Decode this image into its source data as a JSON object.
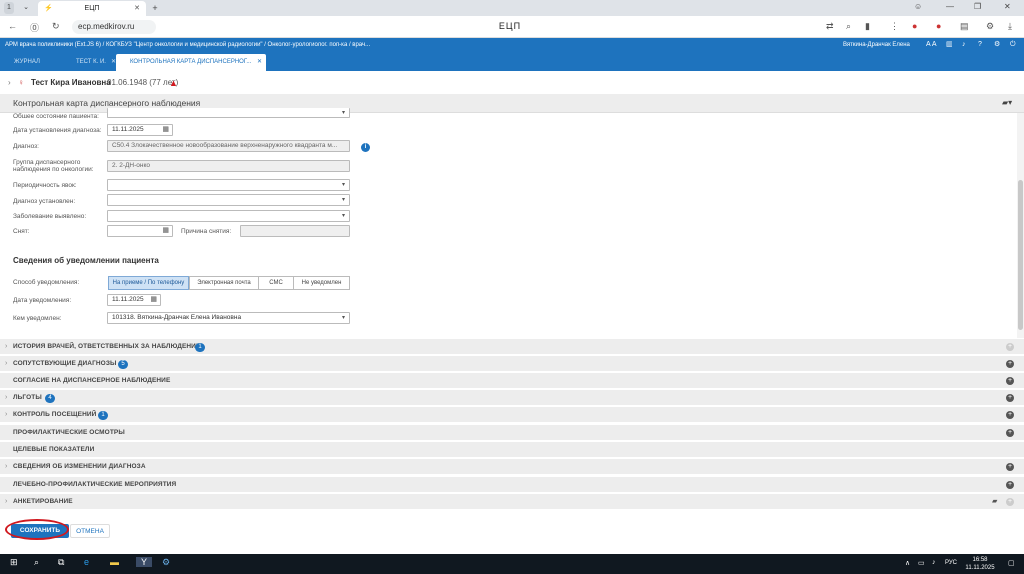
{
  "browser": {
    "tab_counter": "1",
    "tab_title": "ЕЦП",
    "new_tab": "+",
    "url": "ecp.medkirov.ru",
    "page_title": "ЕЦП"
  },
  "app": {
    "header_text": "АРМ врача поликлиники (Ext.JS 6) / КОГКБУЗ \"Центр онкологии и медицинской радиологии\" / Онколог-урологиолог. поп-ка / врач...",
    "user_name": "Вяткина-Дранчак Елена",
    "tabs": [
      {
        "label": "ЖУРНАЛ"
      },
      {
        "label": "ТЕСТ К. И."
      },
      {
        "label": "КОНТРОЛЬНАЯ КАРТА ДИСПАНСЕРНОГ..."
      }
    ]
  },
  "patient": {
    "name": "Тест Кира Ивановна",
    "dob": "01.06.1948 (77 лет)"
  },
  "card": {
    "title": "Контрольная карта диспансерного наблюдения"
  },
  "form": {
    "general_state_label": "Общее состояние пациента:",
    "diag_date_label": "Дата установления диагноза:",
    "diag_date_value": "11.11.2025",
    "diagnosis_label": "Диагноз:",
    "diagnosis_value": "C50.4 Злокачественное новообразование верхненаружного квадранта м...",
    "group_label": "Группа диспансерного наблюдения по онкологии:",
    "group_value": "2. 2-ДН-онко",
    "periodicity_label": "Периодичность явок:",
    "diag_established_label": "Диагноз установлен:",
    "disease_found_label": "Заболевание выявлено:",
    "removed_label": "Снят:",
    "removal_reason_label": "Причина снятия:"
  },
  "notification": {
    "title": "Сведения об уведомлении пациента",
    "method_label": "Способ уведомления:",
    "methods": [
      "На приеме / По телефону",
      "Электронная почта",
      "СМС",
      "Не уведомлен"
    ],
    "date_label": "Дата уведомления:",
    "date_value": "11.11.2025",
    "by_label": "Кем уведомлен:",
    "by_value": "101318. Вяткина-Дранчак Елена Ивановна"
  },
  "sections": [
    {
      "title": "ИСТОРИЯ ВРАЧЕЙ, ОТВЕТСТВЕННЫХ ЗА НАБЛЮДЕНИЕ",
      "badge": "1"
    },
    {
      "title": "СОПУТСТВУЮЩИЕ ДИАГНОЗЫ",
      "badge": "5"
    },
    {
      "title": "СОГЛАСИЕ НА ДИСПАНСЕРНОЕ НАБЛЮДЕНИЕ",
      "badge": ""
    },
    {
      "title": "ЛЬГОТЫ",
      "badge": "4"
    },
    {
      "title": "КОНТРОЛЬ ПОСЕЩЕНИЙ",
      "badge": "1"
    },
    {
      "title": "ПРОФИЛАКТИЧЕСКИЕ ОСМОТРЫ",
      "badge": ""
    },
    {
      "title": "ЦЕЛЕВЫЕ ПОКАЗАТЕЛИ",
      "badge": ""
    },
    {
      "title": "СВЕДЕНИЯ ОБ ИЗМЕНЕНИИ ДИАГНОЗА",
      "badge": ""
    },
    {
      "title": "ЛЕЧЕБНО-ПРОФИЛАКТИЧЕСКИЕ МЕРОПРИЯТИЯ",
      "badge": ""
    },
    {
      "title": "АНКЕТИРОВАНИЕ",
      "badge": ""
    }
  ],
  "buttons": {
    "save": "СОХРАНИТЬ",
    "cancel": "ОТМЕНА"
  },
  "taskbar": {
    "lang": "РУС",
    "time": "16:58",
    "date": "11.11.2025"
  },
  "colors": {
    "accent": "#1e73be",
    "highlight_oval": "#d0191f"
  }
}
